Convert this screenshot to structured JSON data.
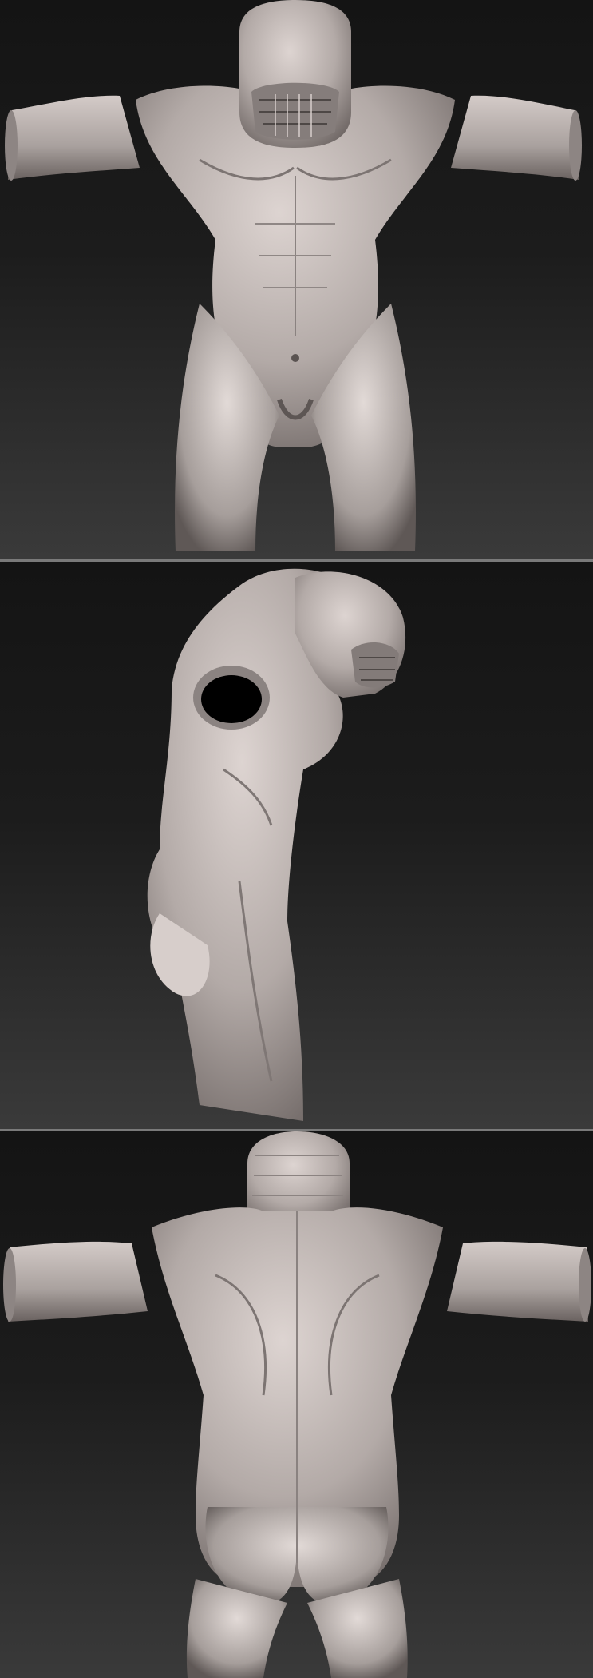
{
  "views": [
    {
      "id": "front",
      "view": "front"
    },
    {
      "id": "side",
      "view": "side"
    },
    {
      "id": "back",
      "view": "back"
    }
  ],
  "colors": {
    "background_top": "#141414",
    "background_bottom": "#3a3a3a",
    "separator": "#7a7a7a",
    "clay_light": "#d8cfcc",
    "clay_mid": "#a8a09d",
    "clay_dark": "#6e6664",
    "shadow": "#3d3836"
  }
}
